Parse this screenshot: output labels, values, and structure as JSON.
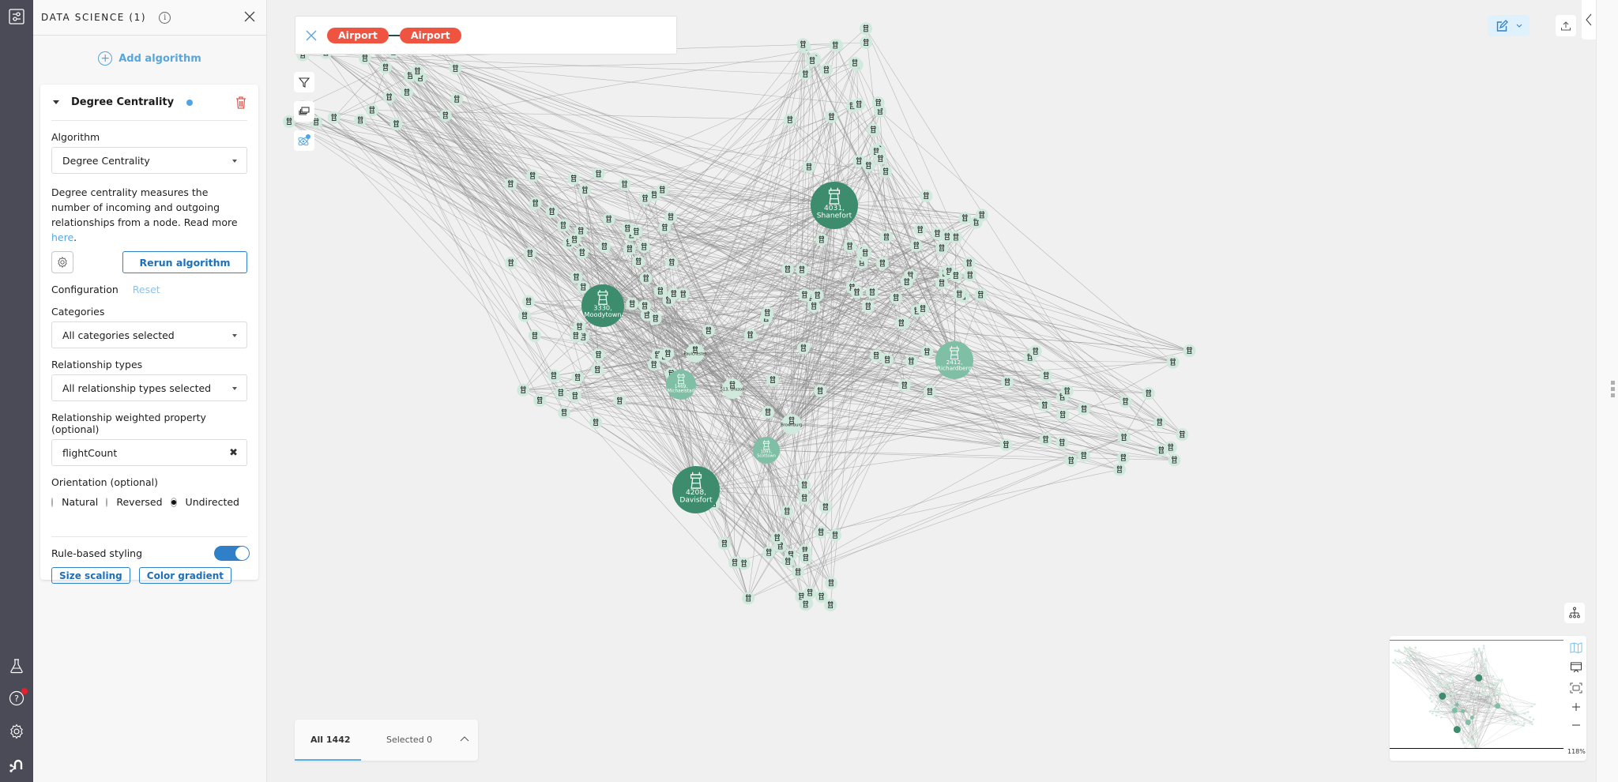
{
  "panel": {
    "title": "DATA SCIENCE (1)",
    "add_algorithm": "Add algorithm",
    "algorithm_card": {
      "title": "Degree Centrality",
      "algorithm_label": "Algorithm",
      "algorithm_value": "Degree Centrality",
      "description_prefix": "Degree centrality measures the number of incoming and outgoing relationships from a node. Read more ",
      "description_link": "here",
      "description_suffix": ".",
      "rerun_label": "Rerun algorithm",
      "configuration_label": "Configuration",
      "reset_label": "Reset",
      "categories_label": "Categories",
      "categories_value": "All categories selected",
      "reltypes_label": "Relationship types",
      "reltypes_value": "All relationship types selected",
      "weight_label": "Relationship weighted property (optional)",
      "weight_value": "flightCount",
      "orientation_label": "Orientation (optional)",
      "orientation_options": [
        "Natural",
        "Reversed",
        "Undirected"
      ],
      "orientation_selected": "Undirected",
      "rule_styling_label": "Rule-based styling",
      "rule_styling_on": true,
      "size_scaling_label": "Size scaling",
      "color_gradient_label": "Color gradient"
    }
  },
  "search": {
    "pattern": [
      "Airport",
      "Airport"
    ]
  },
  "results": {
    "all_label": "All 1442",
    "selected_label": "Selected 0"
  },
  "minimap": {
    "zoom": "118%"
  },
  "colors": {
    "accent": "#2f80c9",
    "pill": "#ef5441",
    "node_large": "#3d8c6e",
    "node_mid": "#7fbfa5",
    "node_small": "#cfe9dd"
  },
  "graph": {
    "hubs": [
      {
        "label": "4031,\nShanefort",
        "size": "large"
      },
      {
        "label": "3330,\nMoodytown",
        "size": "large"
      },
      {
        "label": "4208,\nDavisfort",
        "size": "large"
      },
      {
        "label": "2412,\nRichardberg",
        "size": "mid"
      },
      {
        "label": "1469,\nMichaelstad",
        "size": "mid"
      },
      {
        "label": "1095,\nScottown",
        "size": "mid"
      },
      {
        "label": "513, Orozon",
        "size": "small"
      },
      {
        "label": "Brownburg",
        "size": "small"
      },
      {
        "label": "Paulchester",
        "size": "small"
      }
    ],
    "small_node_count": 230
  }
}
